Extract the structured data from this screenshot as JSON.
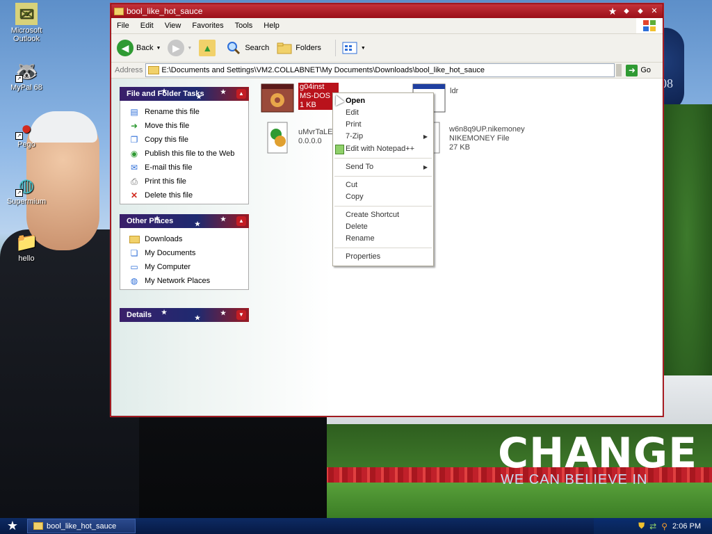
{
  "desktop": {
    "icons": [
      {
        "label": "Microsoft Outlook",
        "glyph": "✉"
      },
      {
        "label": "MyPal 68",
        "glyph": "🦝"
      },
      {
        "label": "Pego",
        "glyph": "●"
      },
      {
        "label": "Supermium",
        "glyph": "◍"
      },
      {
        "label": "hello",
        "glyph": "📁"
      }
    ],
    "wallpaper": {
      "headline": "CHANGE",
      "tagline": "WE CAN BELIEVE IN",
      "seal_text": "08"
    }
  },
  "window": {
    "title": "bool_like_hot_sauce",
    "menu": [
      "File",
      "Edit",
      "View",
      "Favorites",
      "Tools",
      "Help"
    ],
    "toolbar": {
      "back": "Back",
      "search": "Search",
      "folders": "Folders"
    },
    "address": {
      "label": "Address",
      "path": "E:\\Documents and Settings\\VM2.COLLABNET\\My Documents\\Downloads\\bool_like_hot_sauce",
      "go": "Go"
    }
  },
  "taskpane": {
    "file_tasks": {
      "title": "File and Folder Tasks",
      "items": [
        {
          "label": "Rename this file",
          "icon": "rename-icon"
        },
        {
          "label": "Move this file",
          "icon": "move-icon"
        },
        {
          "label": "Copy this file",
          "icon": "copy-icon"
        },
        {
          "label": "Publish this file to the Web",
          "icon": "globe-icon"
        },
        {
          "label": "E-mail this file",
          "icon": "email-icon"
        },
        {
          "label": "Print this file",
          "icon": "printer-icon"
        },
        {
          "label": "Delete this file",
          "icon": "delete-icon"
        }
      ]
    },
    "other_places": {
      "title": "Other Places",
      "items": [
        {
          "label": "Downloads",
          "icon": "folder-icon"
        },
        {
          "label": "My Documents",
          "icon": "documents-icon"
        },
        {
          "label": "My Computer",
          "icon": "computer-icon"
        },
        {
          "label": "My Network Places",
          "icon": "network-icon"
        }
      ]
    },
    "details": {
      "title": "Details"
    }
  },
  "files": [
    {
      "name": "g04inst",
      "type": "MS-DOS B",
      "size": "1 KB",
      "selected": true
    },
    {
      "name": "ldr",
      "type": "",
      "size": ""
    },
    {
      "name": "uMvrTaLE",
      "type": "0.0.0.0",
      "size": ""
    },
    {
      "name": "w6n8q9UP.nikemoney",
      "type": "NIKEMONEY File",
      "size": "27 KB"
    }
  ],
  "context_menu": {
    "open": "Open",
    "edit": "Edit",
    "print": "Print",
    "zip": "7-Zip",
    "notepad": "Edit with Notepad++",
    "send_to": "Send To",
    "cut": "Cut",
    "copy": "Copy",
    "shortcut": "Create Shortcut",
    "delete": "Delete",
    "rename": "Rename",
    "properties": "Properties"
  },
  "taskbar": {
    "task_label": "bool_like_hot_sauce",
    "clock": "2:06 PM"
  }
}
